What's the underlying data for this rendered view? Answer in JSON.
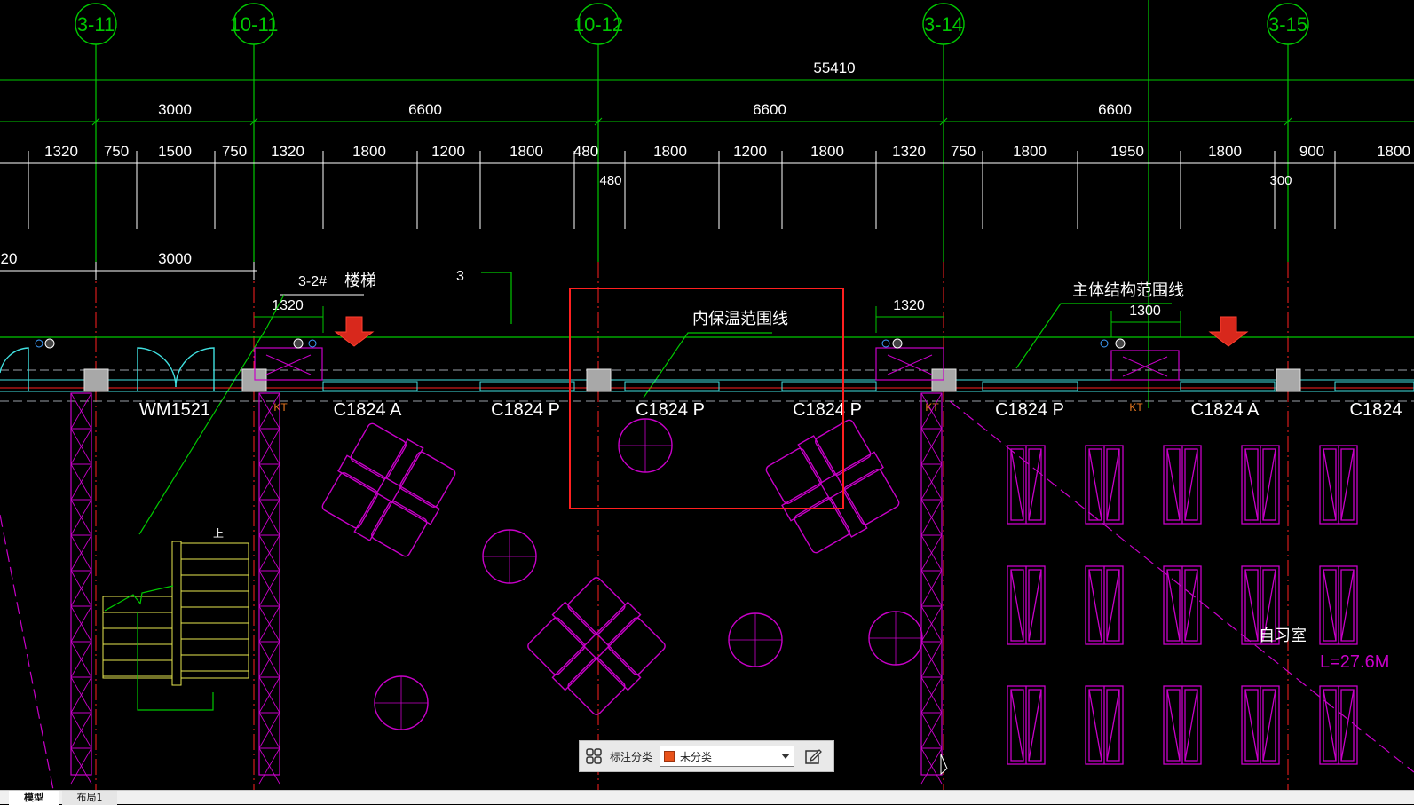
{
  "drawing": {
    "grid_bubbles": [
      "3-11",
      "10-11",
      "10-12",
      "3-14",
      "3-15"
    ],
    "overall_dim": "55410",
    "bay_dims": [
      "3000",
      "6600",
      "6600",
      "6600"
    ],
    "detail_dims": [
      "1320",
      "750",
      "1500",
      "750",
      "1320",
      "1800",
      "1200",
      "1800",
      "480",
      "1800",
      "1200",
      "1800",
      "1320",
      "750",
      "1800",
      "1950",
      "1800",
      "900",
      "1800"
    ],
    "sub_dims": [
      "480",
      "300"
    ],
    "stair_dim_left": "20",
    "stair_dim": "3000",
    "stair_label_id": "3-2#",
    "stair_label": "楼梯",
    "section_mark": "3",
    "dim_1320_a": "1320",
    "dim_1320_b": "1320",
    "dim_1300": "1300",
    "inner_insulation_label": "内保温范围线",
    "main_structure_label": "主体结构范围线",
    "door_label": "WM1521",
    "window_labels": [
      "C1824 A",
      "C1824 P",
      "C1824 P",
      "C1824 P",
      "C1824 P",
      "C1824 A",
      "C1824"
    ],
    "column_tags": [
      "KT",
      "KT",
      "KT"
    ],
    "up_label": "上",
    "room_label": "自习室",
    "length_label": "L=27.6M"
  },
  "annotation_bar": {
    "label": "标注分类",
    "selected": "未分类",
    "swatch_color": "#e8521a",
    "grid_icon": "grid-icon",
    "edit_icon": "edit-icon"
  },
  "tabs": [
    "模型",
    "布局1"
  ],
  "colors": {
    "background": "#000000",
    "grid_line": "#00c800",
    "dimension": "#ffffff",
    "wall": "#c800c8",
    "axis_red": "#ff2020",
    "highlight": "#ff2020",
    "stair": "#e8e850",
    "glass": "#40e0e0"
  }
}
